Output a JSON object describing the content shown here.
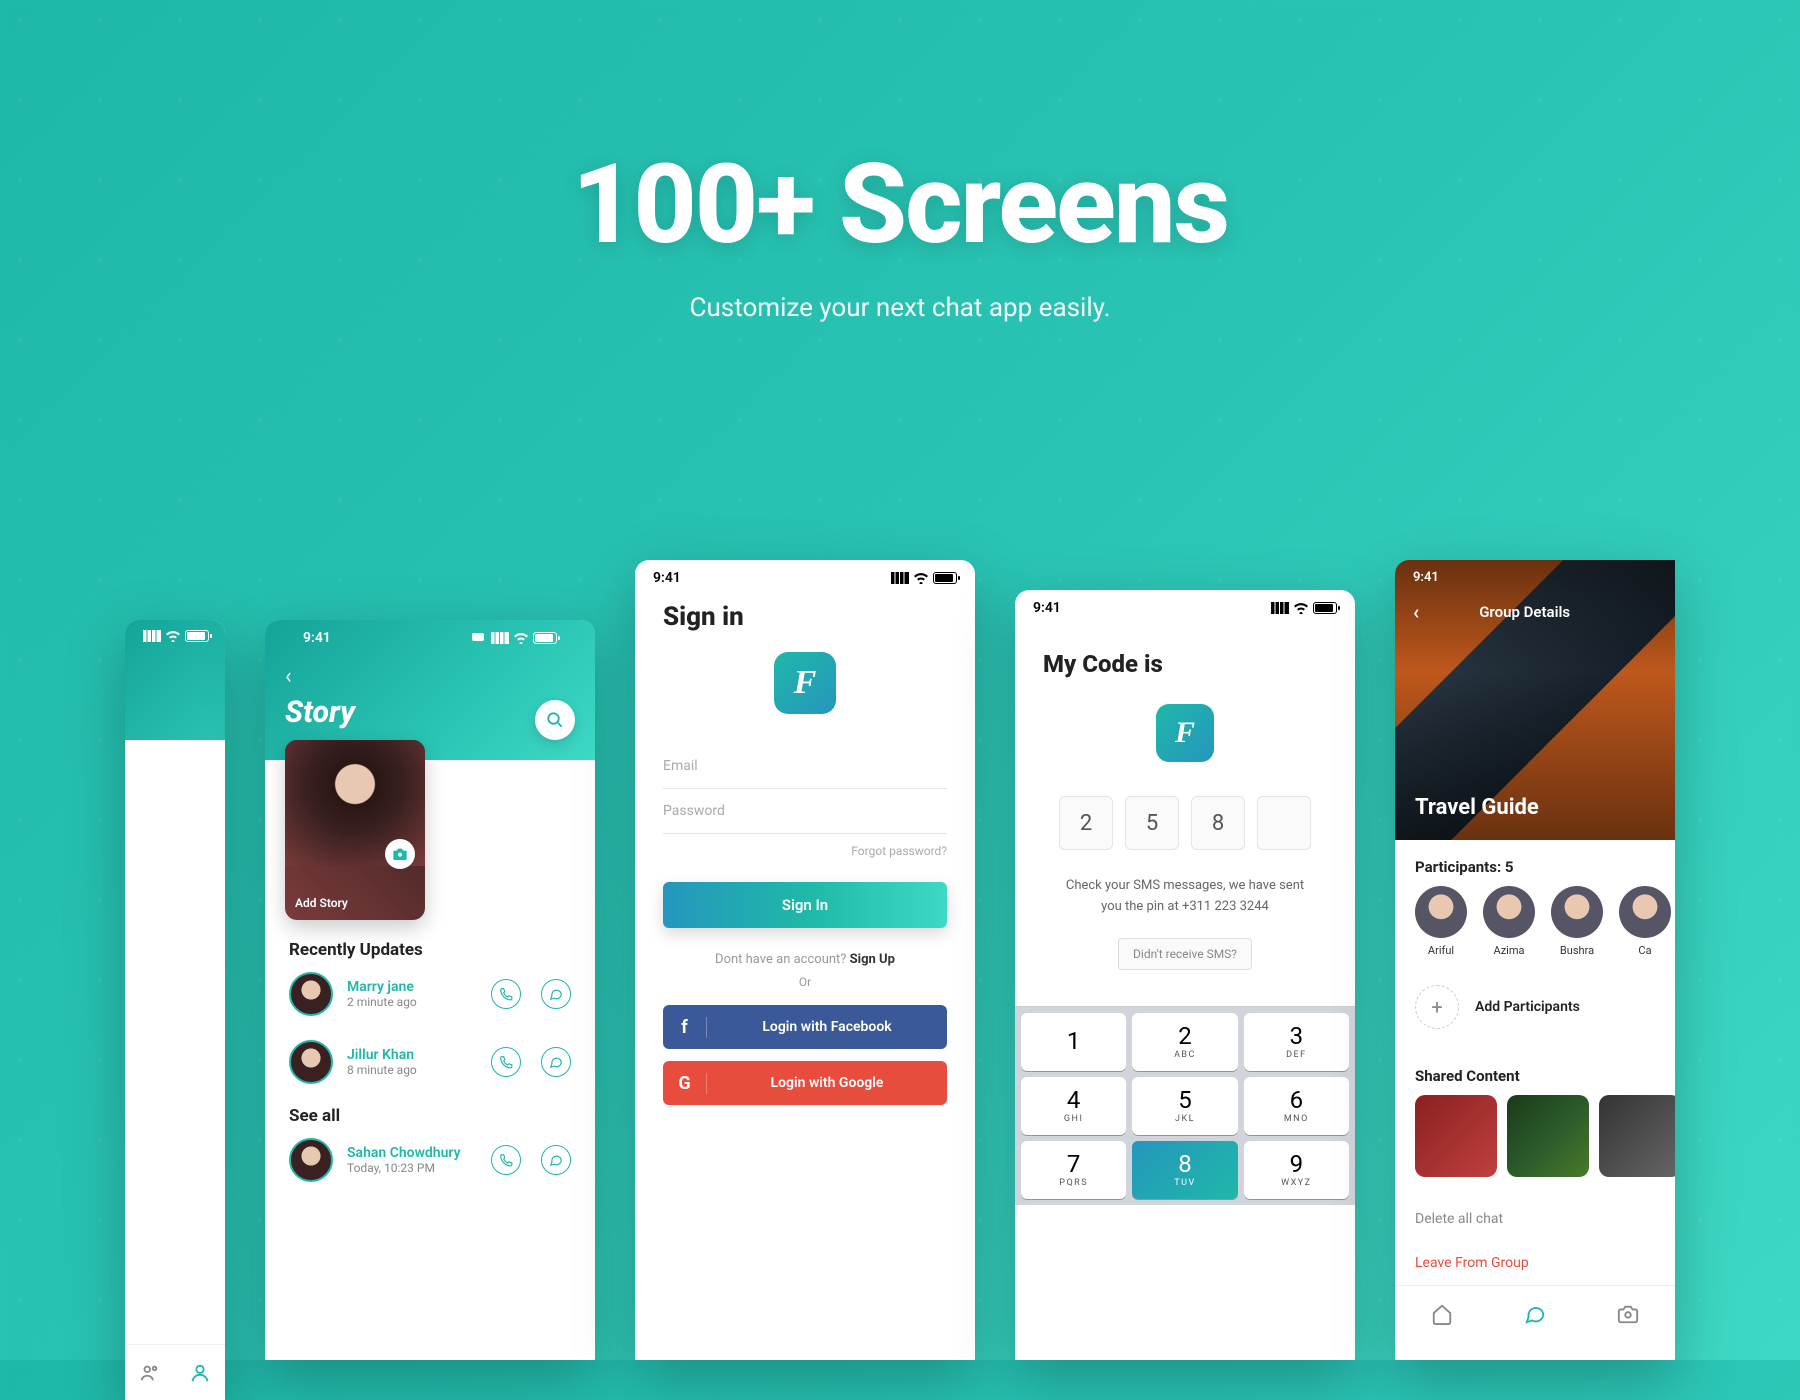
{
  "hero": {
    "title": "100+ Screens",
    "subtitle": "Customize your next chat app easily."
  },
  "status_time": "9:41",
  "story": {
    "title": "Story",
    "add_story": "Add Story",
    "recently": "Recently Updates",
    "see_all": "See all",
    "items": [
      {
        "name": "Marry jane",
        "time": "2 minute ago"
      },
      {
        "name": "Jillur Khan",
        "time": "8 minute ago"
      }
    ],
    "seeall_items": [
      {
        "name": "Sahan Chowdhury",
        "time": "Today, 10:23 PM"
      }
    ]
  },
  "signin": {
    "title": "Sign in",
    "logo": "F",
    "email": "Email",
    "password": "Password",
    "forgot": "Forgot password?",
    "button": "Sign In",
    "note_pre": "Dont have an account? ",
    "note_link": "Sign Up",
    "or": "Or",
    "fb": "Login with Facebook",
    "gg": "Login with Google"
  },
  "code": {
    "title": "My Code is",
    "logo": "F",
    "digits": [
      "2",
      "5",
      "8",
      ""
    ],
    "msg": "Check your SMS messages, we have sent you the pin at +311 223 3244",
    "resend": "Didn't receive SMS?",
    "keys": [
      {
        "n": "1",
        "s": ""
      },
      {
        "n": "2",
        "s": "ABC"
      },
      {
        "n": "3",
        "s": "DEF"
      },
      {
        "n": "4",
        "s": "GHI"
      },
      {
        "n": "5",
        "s": "JKL"
      },
      {
        "n": "6",
        "s": "MNO"
      },
      {
        "n": "7",
        "s": "PQRS"
      },
      {
        "n": "8",
        "s": "TUV"
      },
      {
        "n": "9",
        "s": "WXYZ"
      }
    ]
  },
  "group": {
    "header": "Group Details",
    "title": "Travel Guide",
    "participants_label": "Participants: 5",
    "avatars": [
      {
        "n": "Ariful"
      },
      {
        "n": "Azima"
      },
      {
        "n": "Bushra"
      },
      {
        "n": "Ca"
      }
    ],
    "add": "Add Participants",
    "shared": "Shared Content",
    "delete": "Delete all chat",
    "leave": "Leave From Group"
  }
}
